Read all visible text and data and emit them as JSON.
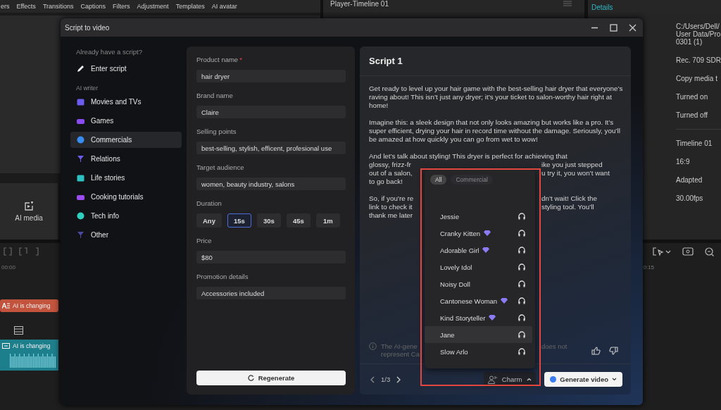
{
  "editor": {
    "toolbar_tabs": [
      "ers",
      "Effects",
      "Transitions",
      "Captions",
      "Filters",
      "Adjustment",
      "Templates",
      "AI avatar"
    ],
    "player_title": "Player-Timeline 01",
    "details_title": "Details",
    "details_sections": [
      [
        {
          "lines": [
            "C:/Users/Dell/",
            "User Data/Pro",
            "0301 (1)"
          ]
        },
        {
          "lines": [
            "Rec. 709 SDR"
          ]
        },
        {
          "lines": [
            "Copy media t"
          ]
        },
        {
          "lines": [
            "Turned on"
          ]
        },
        {
          "lines": [
            "Turned off"
          ]
        }
      ],
      [
        {
          "lines": [
            "Timeline 01"
          ]
        },
        {
          "lines": [
            "16:9"
          ]
        },
        {
          "lines": [
            "Adapted"
          ]
        },
        {
          "lines": [
            "30.00fps"
          ]
        }
      ]
    ],
    "ai_media_label": "AI media",
    "timecode_start": "00:00",
    "timecode_end": "0:15",
    "clips": [
      {
        "kind": "text",
        "label": "AI is changing"
      },
      {
        "kind": "caption",
        "label": "AI is changing"
      }
    ]
  },
  "dialog": {
    "title": "Script to video",
    "sidebar": {
      "script_heading": "Already have a script?",
      "enter_script": "Enter script",
      "writer_heading": "AI writer",
      "categories": [
        {
          "label": "Movies and TVs",
          "selected": false
        },
        {
          "label": "Games",
          "selected": false
        },
        {
          "label": "Commercials",
          "selected": true
        },
        {
          "label": "Relations",
          "selected": false
        },
        {
          "label": "Life stories",
          "selected": false
        },
        {
          "label": "Cooking tutorials",
          "selected": false
        },
        {
          "label": "Tech info",
          "selected": false
        },
        {
          "label": "Other",
          "selected": false
        }
      ]
    },
    "form": {
      "fields": [
        {
          "kind": "text",
          "label": "Product name",
          "required_mark": "*",
          "value": "hair dryer"
        },
        {
          "kind": "text",
          "label": "Brand name",
          "value": "Claire"
        },
        {
          "kind": "text",
          "label": "Selling points",
          "value": "best-selling, stylish, efficent, profesional use"
        },
        {
          "kind": "text",
          "label": "Target audience",
          "value": "women, beauty industry, salons"
        },
        {
          "kind": "choice",
          "label": "Duration",
          "options": [
            {
              "label": "Any",
              "selected": false
            },
            {
              "label": "15s",
              "selected": true
            },
            {
              "label": "30s",
              "selected": false
            },
            {
              "label": "45s",
              "selected": false
            },
            {
              "label": "1m",
              "selected": false
            }
          ]
        },
        {
          "kind": "text",
          "label": "Price",
          "value": "$80"
        },
        {
          "kind": "text",
          "label": "Promotion details",
          "value": "Accessories included"
        }
      ],
      "regenerate": "Regenerate"
    },
    "script": {
      "title": "Script 1",
      "paragraphs": [
        {
          "kind": "text",
          "text": "Get ready to level up your hair game with the best-selling hair dryer that everyone’s raving about! This isn’t just any dryer; it’s your ticket to salon-worthy hair right at home!"
        },
        {
          "kind": "text",
          "text": "Imagine this: a sleek design that not only looks amazing but works like a pro. It’s super efficient, drying your hair in record time without the damage. Seriously, you’ll be amazed at how quickly you can go from wet to wow!"
        },
        {
          "kind": "split",
          "lines": [
            {
              "text": "And let’s talk about styling! This dryer is perfect for achieving that"
            },
            {
              "left": "glossy, frizz-fr",
              "right": "ike you just stepped"
            },
            {
              "left": "out of a salon,",
              "right": "u try it, you won’t want"
            },
            {
              "text": "to go back!"
            }
          ]
        },
        {
          "kind": "split",
          "lines": [
            {
              "left": "So, if you’re re",
              "right": "dn’t wait! Click the"
            },
            {
              "left": "link to check it",
              "right": "styling tool. You’ll"
            },
            {
              "left": "thank me later"
            }
          ]
        }
      ],
      "disclaimer": {
        "left": [
          "The AI-gene",
          "represent Ca"
        ],
        "right": "does not"
      },
      "pager": "1/3",
      "voice_button": "Charm",
      "generate_button": "Generate video"
    },
    "voice_menu": {
      "filters": [
        {
          "label": "All",
          "selected": true
        },
        {
          "label": "Commercial",
          "selected": false
        }
      ],
      "voices": [
        {
          "name": "Jessie",
          "premium": false,
          "selected": false
        },
        {
          "name": "Cranky Kitten",
          "premium": true,
          "selected": false
        },
        {
          "name": "Adorable Girl",
          "premium": true,
          "selected": false
        },
        {
          "name": "Lovely Idol",
          "premium": false,
          "selected": false
        },
        {
          "name": "Noisy Doll",
          "premium": false,
          "selected": false
        },
        {
          "name": "Cantonese Woman",
          "premium": true,
          "selected": false
        },
        {
          "name": "Kind Storyteller",
          "premium": true,
          "selected": false
        },
        {
          "name": "Jane",
          "premium": false,
          "selected": true
        },
        {
          "name": "Slow Arlo",
          "premium": false,
          "selected": false
        }
      ]
    }
  }
}
